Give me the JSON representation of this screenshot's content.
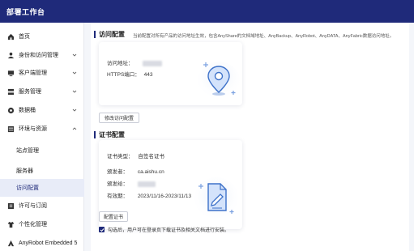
{
  "app": {
    "title": "部署工作台"
  },
  "sidebar": {
    "items": [
      {
        "label": "首页",
        "icon": "home-icon"
      },
      {
        "label": "身份和访问管理",
        "icon": "user-icon"
      },
      {
        "label": "客户端管理",
        "icon": "client-icon"
      },
      {
        "label": "服务管理",
        "icon": "service-icon"
      },
      {
        "label": "数据桶",
        "icon": "database-icon"
      },
      {
        "label": "环境与资源",
        "icon": "environment-icon"
      },
      {
        "label": "站点管理"
      },
      {
        "label": "服务器"
      },
      {
        "label": "访问配置"
      },
      {
        "label": "许可与订阅",
        "icon": "license-icon"
      },
      {
        "label": "个性化管理",
        "icon": "shirt-icon"
      },
      {
        "label": "AnyRobot Embedded 5",
        "icon": "robot-icon"
      }
    ]
  },
  "access": {
    "title": "访问配置",
    "description": "当前配置对所有产品的访问地址生效，包含AnyShare的文档域地址、AnyBackup、AnyRobot、AnyDATA、AnyFabric数据访问地址。",
    "address_label": "访问地址：",
    "https_label": "HTTPS端口：",
    "https_value": "443",
    "modify_button": "修改访问配置"
  },
  "cert": {
    "title": "证书配置",
    "type_label": "证书类型：",
    "type_value": "自签名证书",
    "issuer_label": "颁发者：",
    "issuer_value": "ca.aishu.cn",
    "issued_to_label": "颁发给：",
    "validity_label": "有效期：",
    "validity_value": "2023/11/16-2023/11/13",
    "config_button": "配置证书"
  },
  "download": {
    "checked": true,
    "label": "勾选后，用户可在登录页下载证书及相关文档进行安装。"
  },
  "colors": {
    "brand": "#1f2a7a",
    "illus": "#5b8fd6"
  }
}
